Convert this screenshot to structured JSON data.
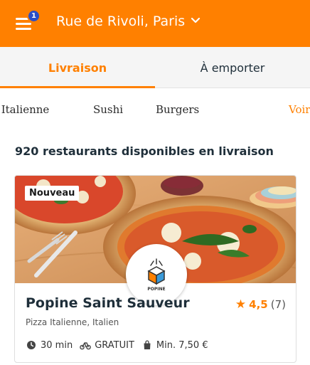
{
  "header": {
    "location": "Rue de Rivoli, Paris",
    "notification_count": "1",
    "brand_color": "#ff8000",
    "badge_color": "#2a4ec9"
  },
  "tabs": [
    {
      "label": "Livraison",
      "active": true
    },
    {
      "label": "À emporter",
      "active": false
    }
  ],
  "categories": [
    "a Italienne",
    "Sushi",
    "Burgers",
    "Voir"
  ],
  "results": {
    "count_text": "920 restaurants disponibles en livraison"
  },
  "restaurant": {
    "badge": "Nouveau",
    "logo_text": "POPINE",
    "name": "Popine Saint Sauveur",
    "rating": "4,5",
    "reviews": "(7)",
    "cuisine": "Pizza Italienne, Italien",
    "delivery_time": "30 min",
    "delivery_fee": "GRATUIT",
    "minimum": "Min. 7,50 €"
  },
  "icons": {
    "menu": "hamburger-menu-icon",
    "location_chevron": "chevron-down-icon",
    "rating": "star-icon",
    "time": "clock-icon",
    "delivery": "bike-icon",
    "minimum": "bag-icon"
  }
}
